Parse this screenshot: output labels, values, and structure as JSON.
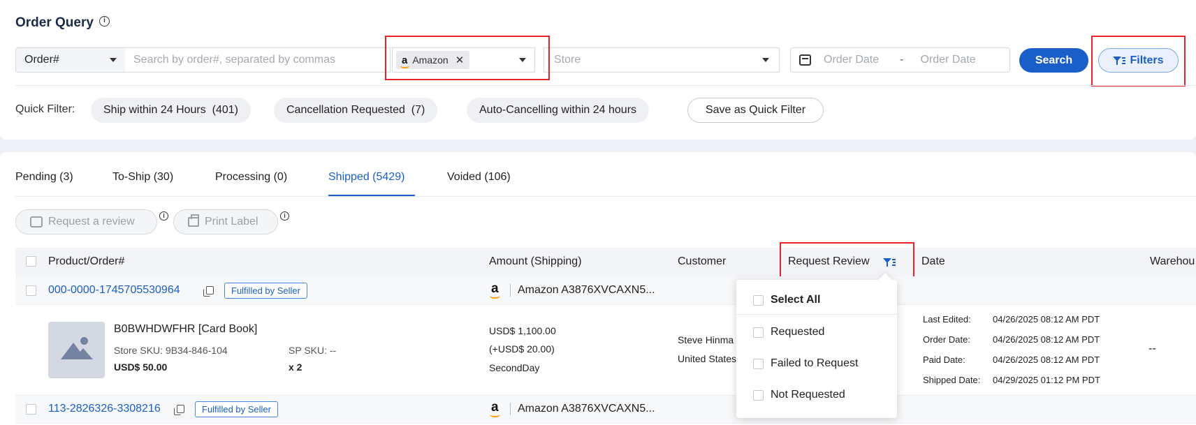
{
  "header": {
    "title": "Order Query"
  },
  "search": {
    "type_select": "Order#",
    "placeholder": "Search by order#, separated by commas",
    "platform_chip": "Amazon",
    "store_placeholder": "Store",
    "date_start_placeholder": "Order Date",
    "date_sep": "-",
    "date_end_placeholder": "Order Date",
    "search_label": "Search",
    "filters_label": "Filters"
  },
  "quick_filter": {
    "label": "Quick Filter:",
    "items": [
      {
        "label": "Ship within 24 Hours",
        "count": "(401)"
      },
      {
        "label": "Cancellation Requested",
        "count": "(7)"
      },
      {
        "label": "Auto-Cancelling within 24 hours",
        "count": ""
      }
    ],
    "save_label": "Save as Quick Filter"
  },
  "tabs": [
    {
      "label": "Pending (3)"
    },
    {
      "label": "To-Ship (30)"
    },
    {
      "label": "Processing (0)"
    },
    {
      "label": "Shipped (5429)"
    },
    {
      "label": "Voided (106)"
    }
  ],
  "actions": {
    "request_review": "Request a review",
    "print_label": "Print Label"
  },
  "table": {
    "columns": [
      "Product/Order#",
      "Amount (Shipping)",
      "Customer",
      "Request Review",
      "Date",
      "Warehou"
    ],
    "orders": [
      {
        "order_no": "000-0000-1745705530964",
        "badge": "Fulfilled by Seller",
        "store": "Amazon A3876XVCAXN5...",
        "product": {
          "title": "B0BWHDWFHR [Card Book]",
          "store_sku": "Store SKU: 9B34-846-104",
          "sp_sku": "SP SKU: --",
          "price": "USD$ 50.00",
          "qty": "x 2"
        },
        "amount": "USD$ 1,100.00",
        "shipping": "(+USD$ 20.00)",
        "ship_method": "SecondDay",
        "customer_name": "Steve Hinma",
        "customer_country": "United States",
        "dates": [
          {
            "label": "Last Edited:",
            "value": "04/26/2025 08:12 AM PDT"
          },
          {
            "label": "Order Date:",
            "value": "04/26/2025 08:12 AM PDT"
          },
          {
            "label": "Paid Date:",
            "value": "04/26/2025 08:12 AM PDT"
          },
          {
            "label": "Shipped Date:",
            "value": "04/29/2025 01:12 PM PDT"
          }
        ],
        "warehouse": "--"
      },
      {
        "order_no": "113-2826326-3308216",
        "badge": "Fulfilled by Seller",
        "store": "Amazon A3876XVCAXN5..."
      }
    ]
  },
  "review_dropdown": {
    "items": [
      "Select All",
      "Requested",
      "Failed to Request",
      "Not Requested"
    ]
  },
  "colors": {
    "accent": "#1a5fc9",
    "highlight": "#e8232a"
  }
}
